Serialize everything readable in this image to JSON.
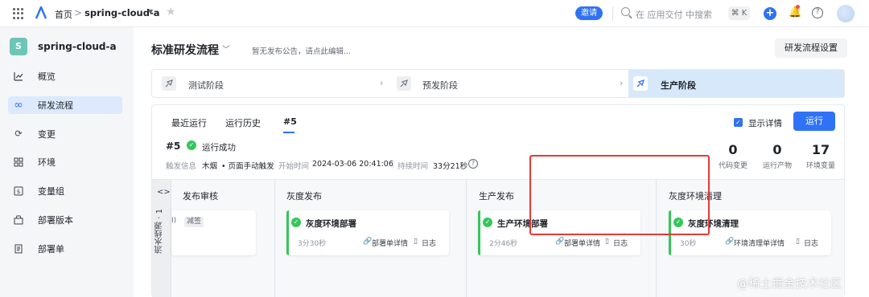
{
  "topbar": {
    "home": "首页",
    "separator": ">",
    "project": "spring-cloud-a",
    "invite_label": "邀请",
    "search_placeholder": "在 应用交付 中搜索",
    "shortcut": "⌘ K",
    "plus": "+",
    "help": "?"
  },
  "sidebar": {
    "project_initial": "S",
    "project_name": "spring-cloud-a",
    "items": [
      {
        "label": "概览",
        "icon": "chart-icon"
      },
      {
        "label": "研发流程",
        "icon": "infinity-icon",
        "active": true
      },
      {
        "label": "变更",
        "icon": "change-icon"
      },
      {
        "label": "环境",
        "icon": "grid-icon"
      },
      {
        "label": "变量组",
        "icon": "variable-icon"
      },
      {
        "label": "部署版本",
        "icon": "package-icon"
      },
      {
        "label": "部署单",
        "icon": "document-icon"
      }
    ]
  },
  "header": {
    "title": "标准研发流程",
    "announcement": "暂无发布公告，请点此编辑...",
    "settings_label": "研发流程设置"
  },
  "stages": [
    {
      "label": "测试阶段"
    },
    {
      "label": "预发阶段"
    },
    {
      "label": "生产阶段",
      "active": true
    }
  ],
  "run_panel": {
    "tabs": [
      "最近运行",
      "运行历史",
      "#5"
    ],
    "show_details_label": "显示详情",
    "run_label": "运行",
    "run_number": "#5",
    "status": "运行成功",
    "trigger_label": "触发信息",
    "trigger_user": "木烟",
    "trigger_method": "• 页面手动触发",
    "start_label": "开始时间",
    "start_time": "2024-03-06 20:41:06",
    "duration_label": "持续时间",
    "duration": "33分21秒",
    "stats": [
      {
        "value": "0",
        "label": "代码变更"
      },
      {
        "value": "0",
        "label": "运行产物"
      },
      {
        "value": "17",
        "label": "环境变量"
      }
    ]
  },
  "pipeline": {
    "lane_label": "流水线源 · 1",
    "partial_card_text": "I)",
    "partial_card_tag": "减签",
    "columns": [
      {
        "title": "发布审核"
      },
      {
        "title": "灰度发布",
        "job": {
          "name": "灰度环境部署",
          "time": "3分30秒",
          "link1": "部署单详情",
          "link2": "日志"
        }
      },
      {
        "title": "生产发布",
        "job": {
          "name": "生产环境部署",
          "time": "2分46秒",
          "link1": "部署单详情",
          "link2": "日志"
        }
      },
      {
        "title": "灰度环境清理",
        "job": {
          "name": "灰度环境清理",
          "time": "30秒",
          "link1": "环境清理单详情",
          "link2": "日志"
        }
      }
    ]
  },
  "watermark": "@稀土掘金技术社区",
  "colors": {
    "accent": "#2f72f5",
    "success": "#34c759",
    "highlight": "#e53935"
  }
}
